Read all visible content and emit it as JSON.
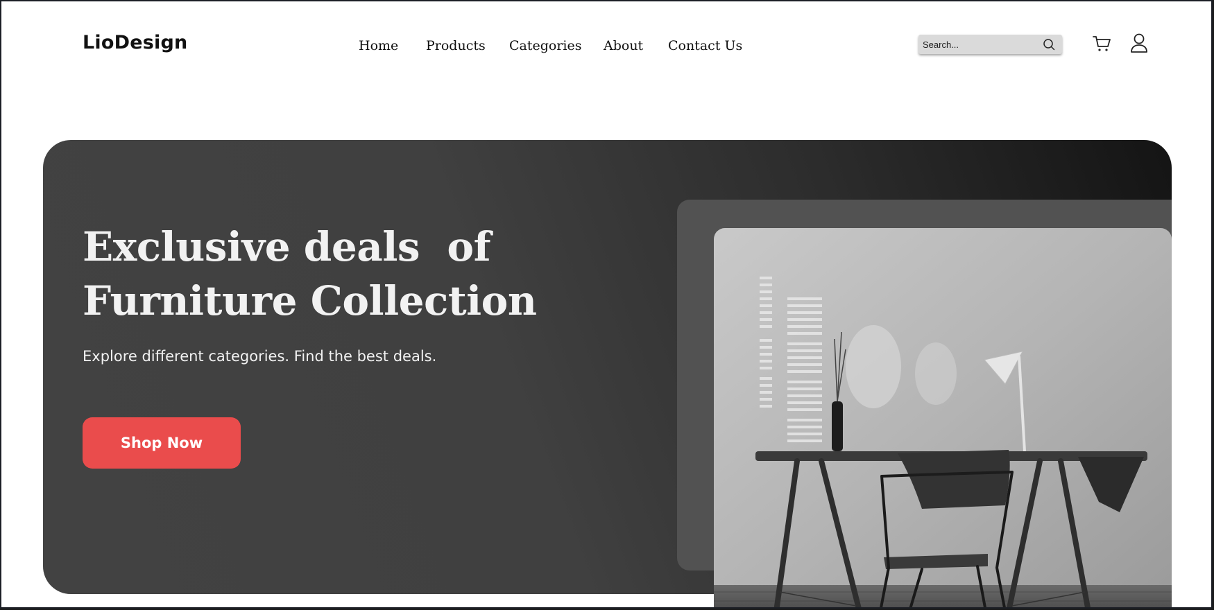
{
  "header": {
    "logo": "LioDesign",
    "nav": [
      "Home",
      "Products",
      "Categories",
      "About",
      "Contact Us"
    ],
    "search": {
      "placeholder": "Search..."
    },
    "icons": [
      "search-icon",
      "cart-icon",
      "user-icon"
    ]
  },
  "hero": {
    "title_line1": "Exclusive deals  of",
    "title_line2": "Furniture Collection",
    "subtitle": "Explore different categories. Find the best deals.",
    "cta_label": "Shop Now",
    "cta_color": "#ea4c4c",
    "image": "furniture-desk-chair-photo"
  }
}
